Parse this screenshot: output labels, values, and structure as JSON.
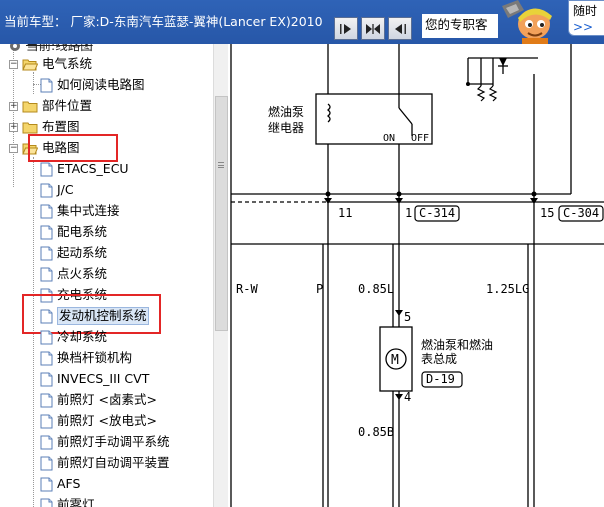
{
  "header": {
    "title": "当前车型：  厂家:D-东南汽车蓝瑟-翼神(Lancer EX)2010",
    "slogan": "您的专职客",
    "bubble_line1": "随时",
    "bubble_line2": ">>"
  },
  "tree": {
    "partial_top": "当前:线路图",
    "electrical_system": "电气系统",
    "how_to_read": "如何阅读电路图",
    "component_location": "部件位置",
    "layout": "布置图",
    "wiring_diagram": "电路图",
    "items": [
      "ETACS_ECU",
      "J/C",
      "集中式连接",
      "配电系统",
      "起动系统",
      "点火系统",
      "充电系统",
      "发动机控制系统",
      "冷却系统",
      "换档杆锁机构",
      "INVECS_III CVT",
      "前照灯 <卤素式>",
      "前照灯 <放电式>",
      "前照灯手动调平系统",
      "前照灯自动调平装置",
      "AFS",
      "前雾灯"
    ]
  },
  "diagram": {
    "relay_label_1": "燃油泵",
    "relay_label_2": "继电器",
    "relay_on": "ON",
    "relay_off": "OFF",
    "pin_11": "11",
    "pin_1": "1",
    "conn_c314": "C-314",
    "pin_15": "15",
    "conn_c304": "C-304",
    "wire_rw": "R-W",
    "wire_p": "P",
    "wire_085l": "0.85L",
    "wire_125lg": "1.25LG",
    "pin_5": "5",
    "pump_label_1": "燃油泵和燃油",
    "pump_label_2": "表总成",
    "conn_d19": "D-19",
    "pin_4": "4",
    "wire_085b": "0.85B",
    "motor_symbol": "M"
  }
}
